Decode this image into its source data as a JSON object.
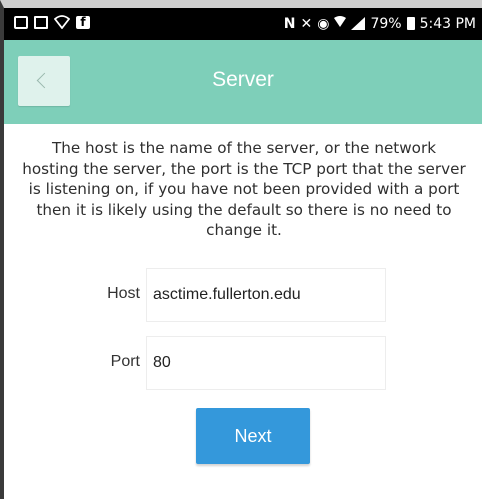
{
  "status_bar": {
    "battery": "79%",
    "time": "5:43 PM",
    "icons": [
      "screenshot-icon",
      "image-icon",
      "wifi-icon",
      "facebook-icon",
      "nfc-icon",
      "mute-icon",
      "alarm-icon",
      "wifi-icon",
      "signal-icon",
      "battery-icon"
    ]
  },
  "header": {
    "title": "Server",
    "accent_color": "#7ecfb9",
    "back_icon": "chevron-left-icon"
  },
  "description": "The host is the name of the server, or the network hosting the server, the port is the TCP port that the server is listening on, if you have not been provided with a port then it is likely using the default so there is no need to change it.",
  "form": {
    "host_label": "Host",
    "host_value": "asctime.fullerton.edu",
    "port_label": "Port",
    "port_value": "80"
  },
  "next_button": {
    "label": "Next",
    "color": "#3498db"
  }
}
